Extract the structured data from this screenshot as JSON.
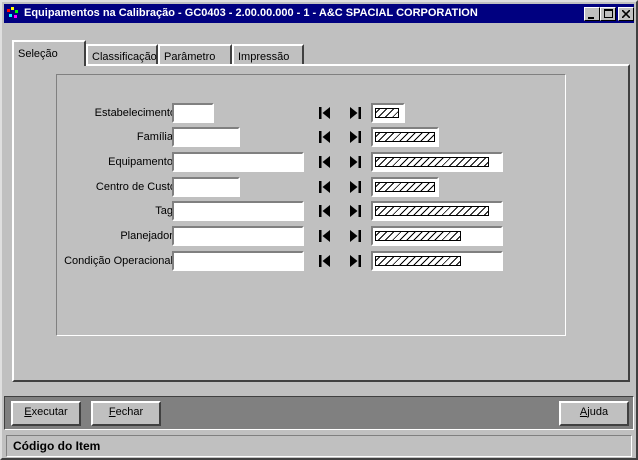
{
  "window": {
    "title": "Equipamentos na Calibração - GC0403 - 2.00.00.000 - 1 - A&C SPACIAL CORPORATION",
    "controls": [
      "minimize-icon",
      "maximize-icon",
      "close-icon"
    ]
  },
  "tabs": [
    {
      "label": "Seleção",
      "active": true
    },
    {
      "label": "Classificação",
      "active": false
    },
    {
      "label": "Parâmetro",
      "active": false
    },
    {
      "label": "Impressão",
      "active": false
    }
  ],
  "fields": [
    {
      "label": "Estabelecimento",
      "start_value": "",
      "end_value": "ZZZ"
    },
    {
      "label": "Família:",
      "start_value": "",
      "end_value": "ZZZZZZZZ"
    },
    {
      "label": "Equipamento:",
      "start_value": "",
      "end_value": "ZZZZZZZZZZZZZZZZZZZZ"
    },
    {
      "label": "Centro de Custo",
      "start_value": "",
      "end_value": "ZZZZZZZZ"
    },
    {
      "label": "Tag:",
      "start_value": "",
      "end_value": "ZZZZZZZZZZZZZZZZZZZZ"
    },
    {
      "label": "Planejador:",
      "start_value": "",
      "end_value": "ZZZZZZZZZZZZZZZ"
    },
    {
      "label": "Condição Operacional:",
      "start_value": "",
      "end_value": "ZZZZZZZZZZZZZZZ"
    }
  ],
  "buttons": {
    "executar": {
      "underline": "E",
      "rest": "xecutar"
    },
    "fechar": {
      "underline": "F",
      "rest": "echar"
    },
    "ajuda": {
      "underline": "A",
      "rest": "juda"
    }
  },
  "status": {
    "text": "Código do Item"
  }
}
